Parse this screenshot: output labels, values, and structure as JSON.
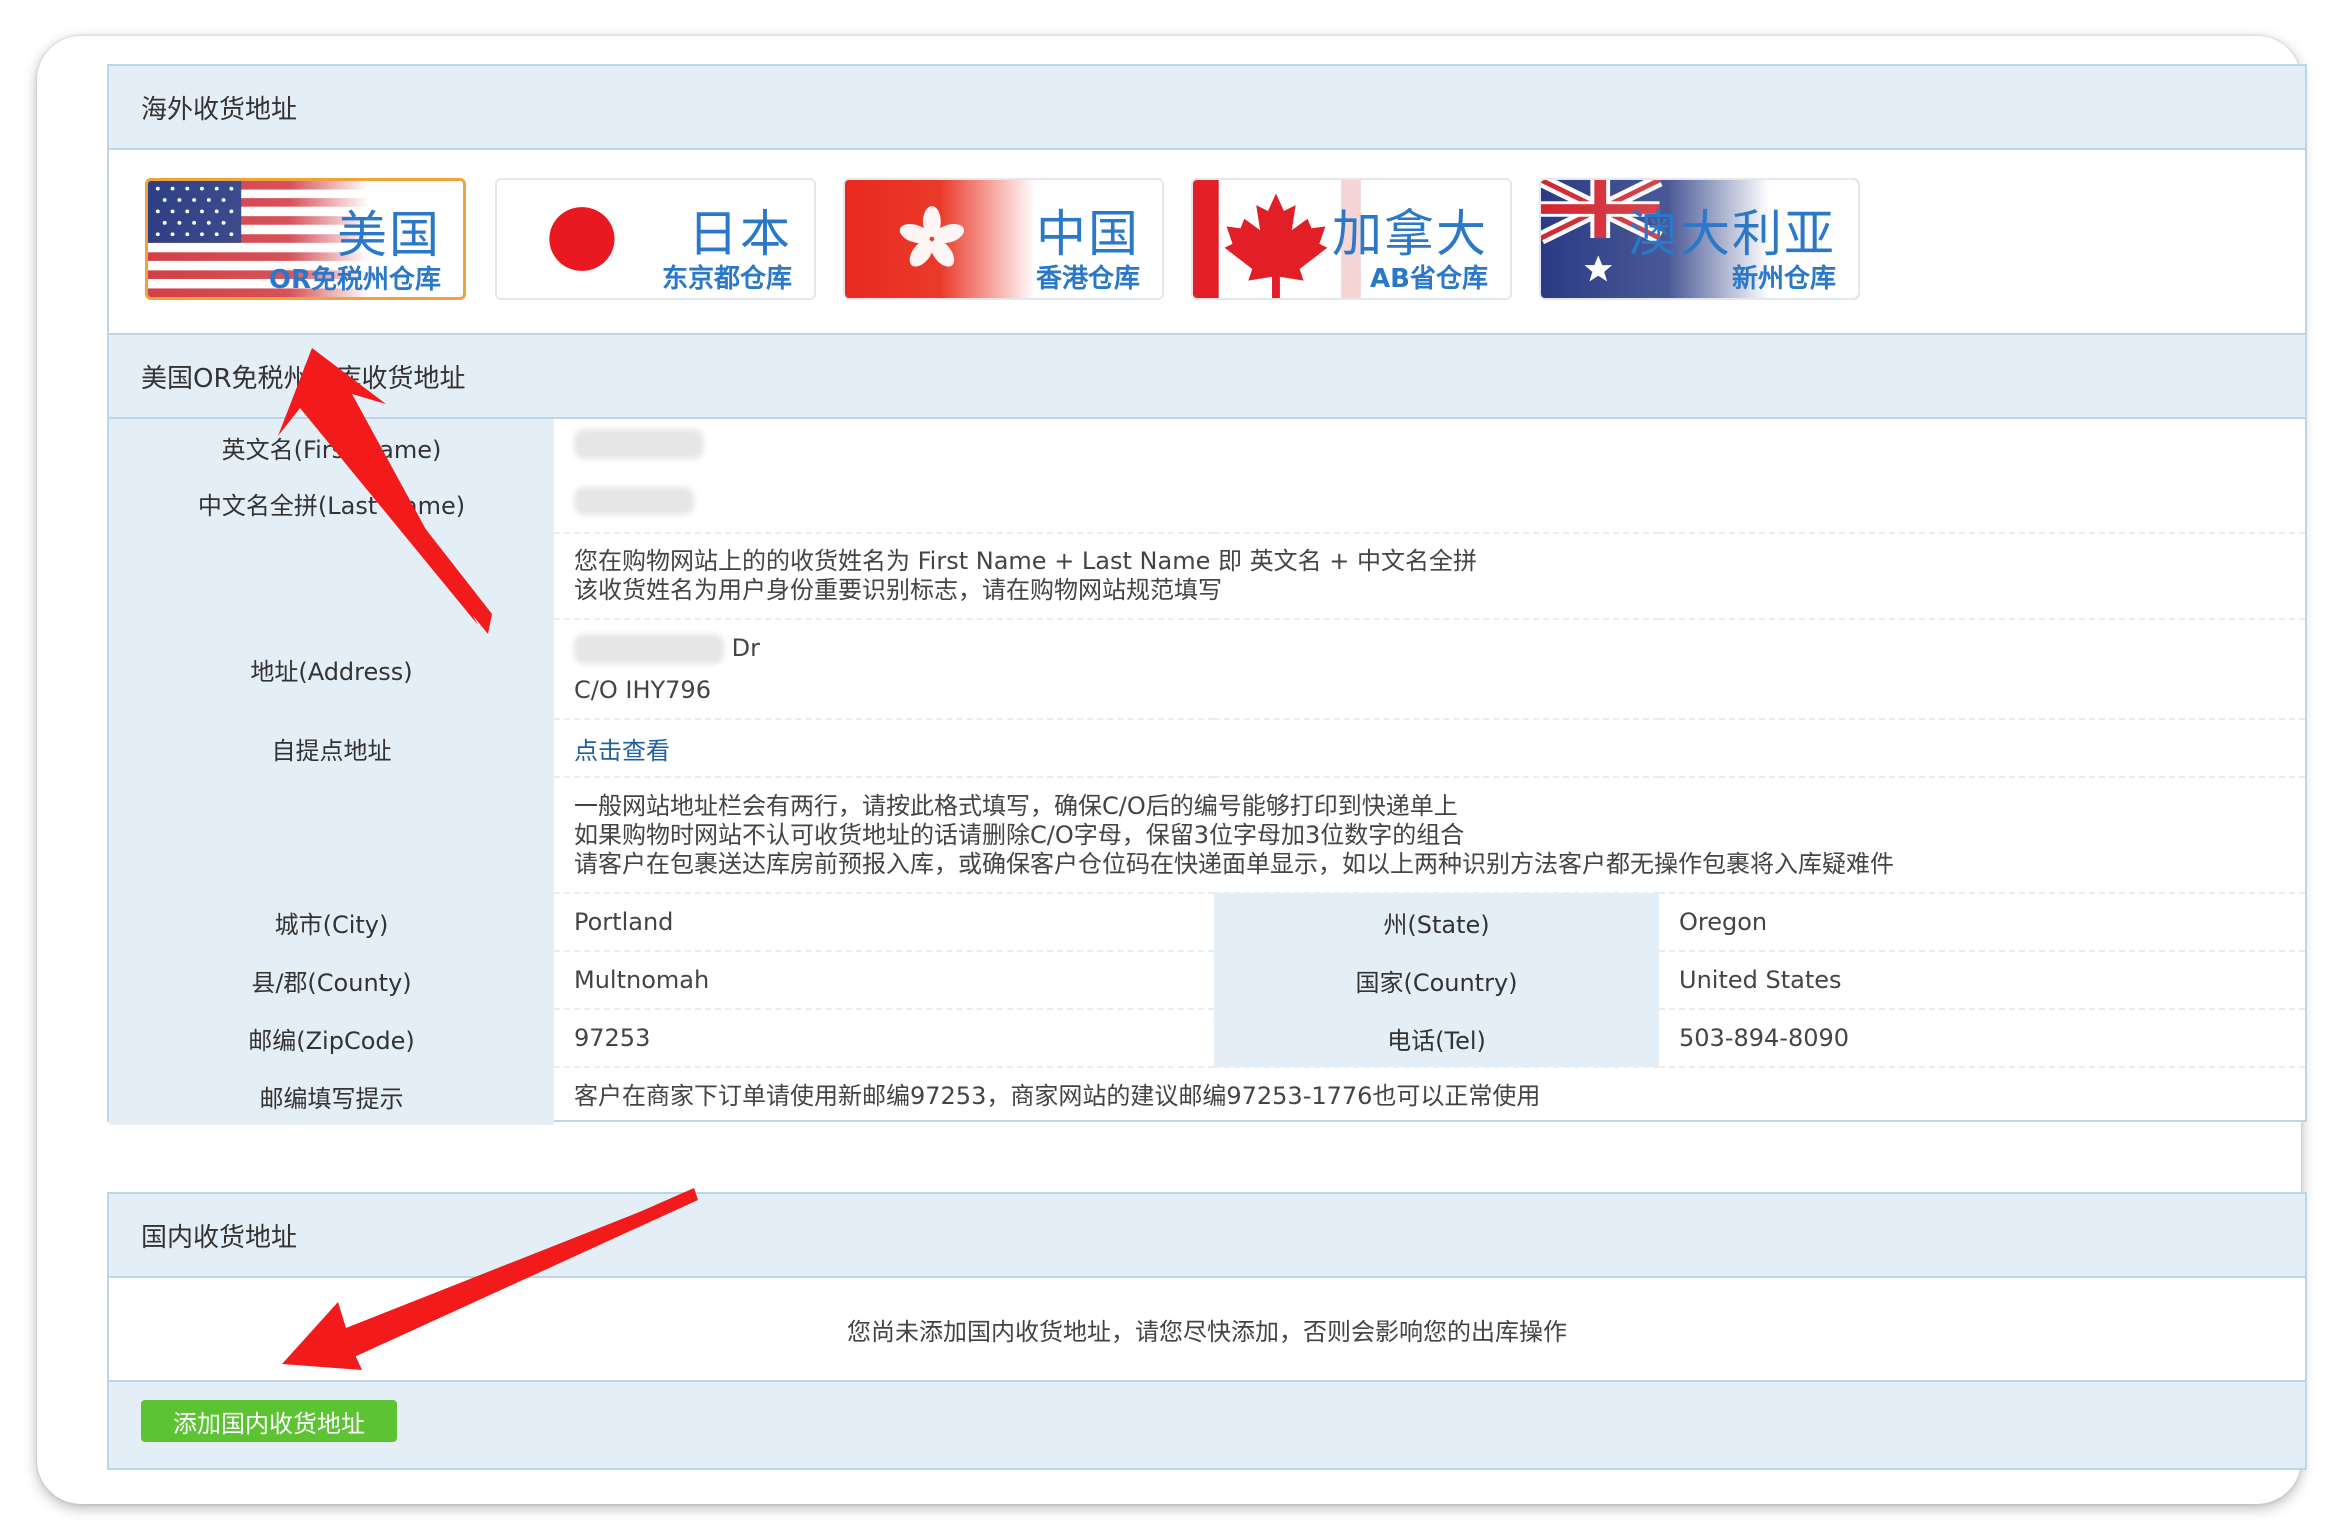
{
  "overseas": {
    "title": "海外收货地址",
    "warehouses": [
      {
        "name": "美国",
        "sub": "OR免税州仓库",
        "active": true
      },
      {
        "name": "日本",
        "sub": "东京都仓库",
        "active": false
      },
      {
        "name": "中国",
        "sub": "香港仓库",
        "active": false
      },
      {
        "name": "加拿大",
        "sub": "AB省仓库",
        "active": false
      },
      {
        "name": "澳大利亚",
        "sub": "新州仓库",
        "active": false
      }
    ]
  },
  "us_address": {
    "title": "美国OR免税州仓库收货地址",
    "first_name_label": "英文名(First Name)",
    "last_name_label": "中文名全拼(Last Name)",
    "name_note_1": "您在购物网站上的的收货姓名为 First Name + Last Name 即 英文名 + 中文名全拼",
    "name_note_2": "该收货姓名为用户身份重要识别标志，请在购物网站规范填写",
    "address_label": "地址(Address)",
    "address_suffix": "Dr",
    "address_line2": "C/O IHY796",
    "pickup_label": "自提点地址",
    "pickup_link": "点击查看",
    "addr_note_1": "一般网站地址栏会有两行，请按此格式填写，确保C/O后的编号能够打印到快递单上",
    "addr_note_2": "如果购物时网站不认可收货地址的话请删除C/O字母，保留3位字母加3位数字的组合",
    "addr_note_3": "请客户在包裹送达库房前预报入库，或确保客户仓位码在快递面单显示，如以上两种识别方法客户都无操作包裹将入库疑难件",
    "city_label": "城市(City)",
    "city": "Portland",
    "state_label": "州(State)",
    "state": "Oregon",
    "county_label": "县/郡(County)",
    "county": "Multnomah",
    "country_label": "国家(Country)",
    "country": "United States",
    "zip_label": "邮编(ZipCode)",
    "zip": "97253",
    "tel_label": "电话(Tel)",
    "tel": "503-894-8090",
    "zip_hint_label": "邮编填写提示",
    "zip_hint": "客户在商家下订单请使用新邮编97253，商家网站的建议邮编97253-1776也可以正常使用"
  },
  "domestic": {
    "title": "国内收货地址",
    "empty_message": "您尚未添加国内收货地址，请您尽快添加，否则会影响您的出库操作",
    "add_button": "添加国内收货地址"
  },
  "colors": {
    "panel_border": "#bcd6e8",
    "panel_head": "#e4eef7",
    "warning_text": "#e2511b",
    "link": "#1f5f9f",
    "button_green": "#5cc332",
    "flag_text": "#2b78c9",
    "active_border": "#f0a23d",
    "arrow": "#f21a1a"
  }
}
